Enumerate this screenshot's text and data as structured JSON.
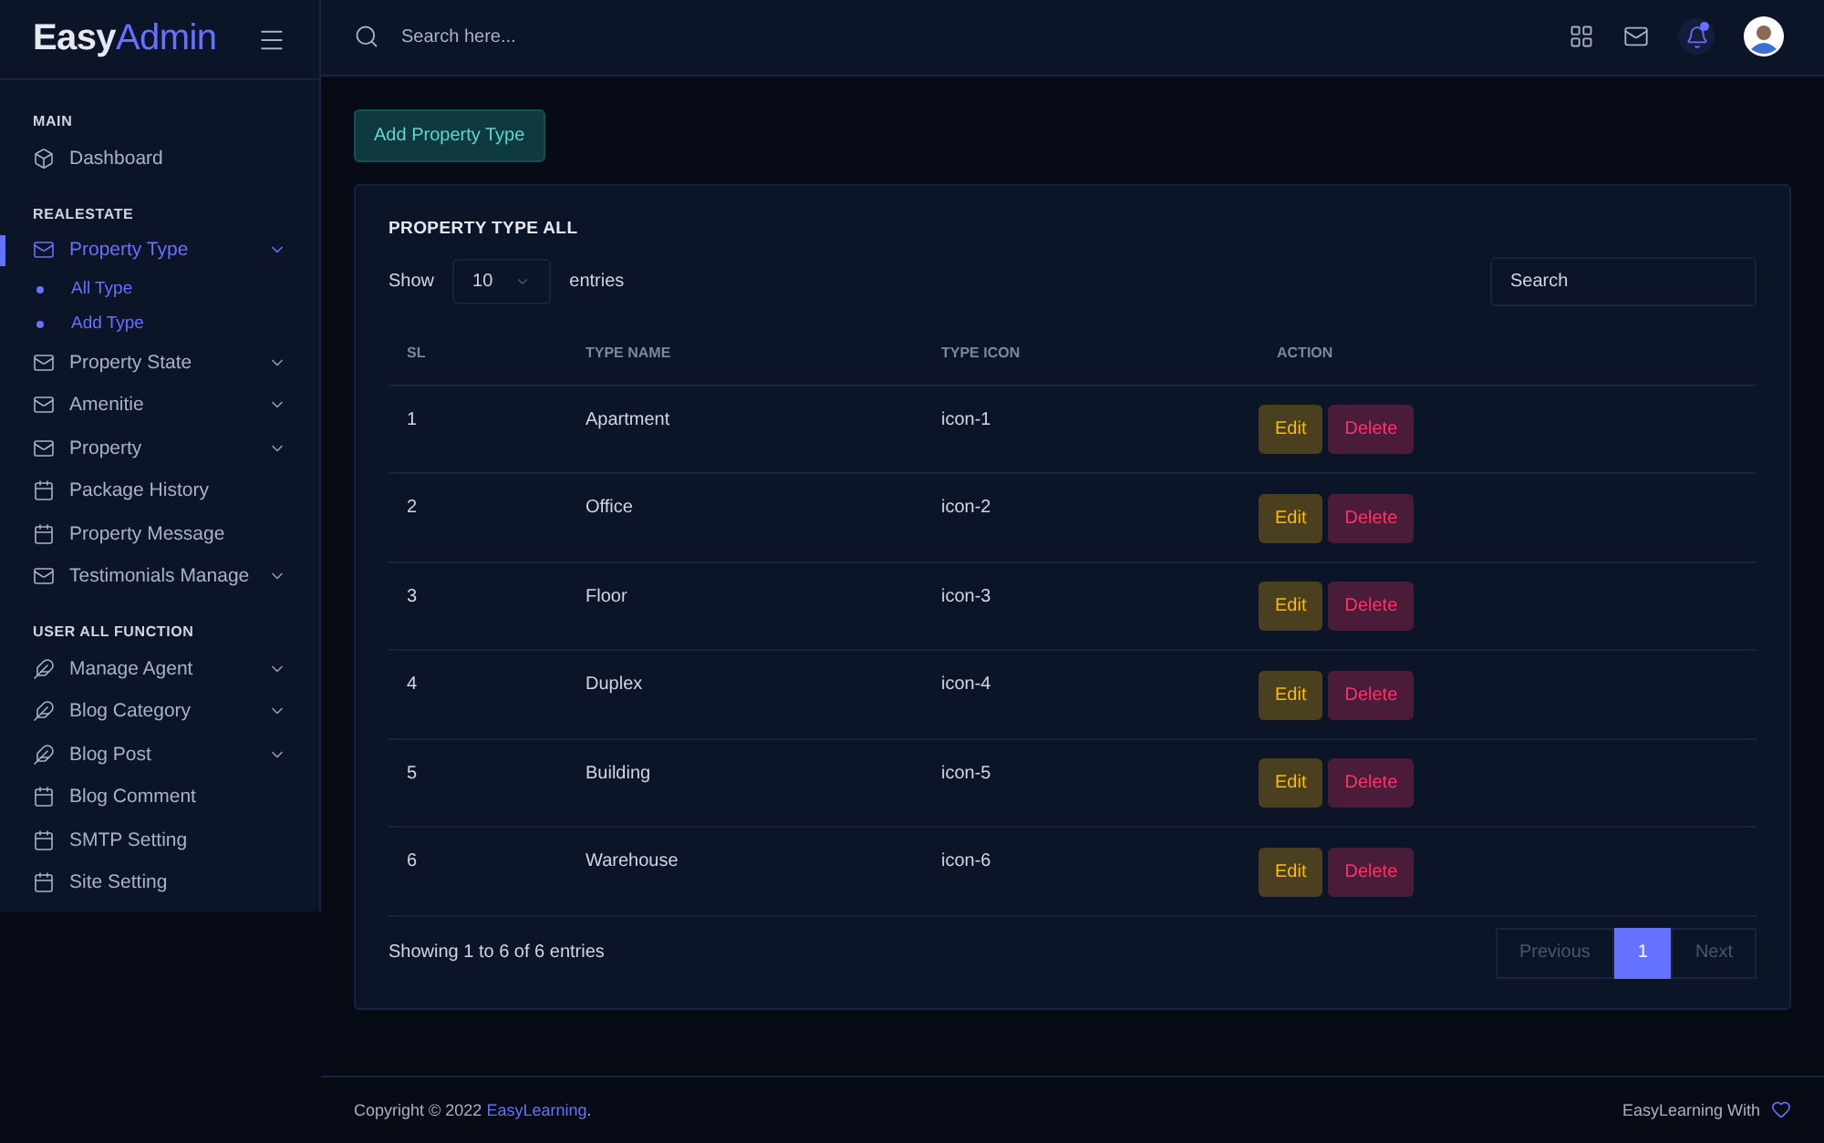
{
  "brand": {
    "strong": "Easy",
    "light": "Admin"
  },
  "search": {
    "placeholder": "Search here..."
  },
  "sidebar": {
    "sections": [
      {
        "title": "MAIN",
        "items": [
          {
            "label": "Dashboard",
            "kind": "cube",
            "selected": false,
            "submenu": false
          }
        ]
      },
      {
        "title": "REALESTATE",
        "items": [
          {
            "label": "Property Type",
            "kind": "envelope",
            "selected": true,
            "submenu": true,
            "expanded": true,
            "children": [
              "All Type",
              "Add Type"
            ]
          },
          {
            "label": "Property State",
            "kind": "envelope",
            "selected": false,
            "submenu": true,
            "expanded": false
          },
          {
            "label": "Amenitie",
            "kind": "envelope",
            "selected": false,
            "submenu": true,
            "expanded": false
          },
          {
            "label": "Property",
            "kind": "envelope",
            "selected": false,
            "submenu": true,
            "expanded": false
          },
          {
            "label": "Package History",
            "kind": "calendar",
            "selected": false,
            "submenu": false
          },
          {
            "label": "Property Message",
            "kind": "calendar",
            "selected": false,
            "submenu": false
          },
          {
            "label": "Testimonials Manage",
            "kind": "envelope",
            "selected": false,
            "submenu": true,
            "expanded": false
          }
        ]
      },
      {
        "title": "USER ALL FUNCTION",
        "items": [
          {
            "label": "Manage Agent",
            "kind": "feather",
            "selected": false,
            "submenu": true,
            "expanded": false
          },
          {
            "label": "Blog Category",
            "kind": "feather",
            "selected": false,
            "submenu": true,
            "expanded": false
          },
          {
            "label": "Blog Post",
            "kind": "feather",
            "selected": false,
            "submenu": true,
            "expanded": false
          },
          {
            "label": "Blog Comment",
            "kind": "calendar",
            "selected": false,
            "submenu": false
          },
          {
            "label": "SMTP Setting",
            "kind": "calendar",
            "selected": false,
            "submenu": false
          },
          {
            "label": "Site Setting",
            "kind": "calendar",
            "selected": false,
            "submenu": false
          }
        ]
      }
    ]
  },
  "add_button": "Add Property Type",
  "card": {
    "title": "PROPERTY TYPE ALL",
    "show_label": "Show",
    "page_size": "10",
    "entries_label": "entries",
    "search_placeholder": "Search",
    "columns": [
      "SL",
      "TYPE NAME",
      "TYPE ICON",
      "ACTION"
    ],
    "rows": [
      {
        "sl": "1",
        "name": "Apartment",
        "icon": "icon-1",
        "edit": "Edit",
        "delete": "Delete"
      },
      {
        "sl": "2",
        "name": "Office",
        "icon": "icon-2",
        "edit": "Edit",
        "delete": "Delete"
      },
      {
        "sl": "3",
        "name": "Floor",
        "icon": "icon-3",
        "edit": "Edit",
        "delete": "Delete"
      },
      {
        "sl": "4",
        "name": "Duplex",
        "icon": "icon-4",
        "edit": "Edit",
        "delete": "Delete"
      },
      {
        "sl": "5",
        "name": "Building",
        "icon": "icon-5",
        "edit": "Edit",
        "delete": "Delete"
      },
      {
        "sl": "6",
        "name": "Warehouse",
        "icon": "icon-6",
        "edit": "Edit",
        "delete": "Delete"
      }
    ],
    "info": "Showing 1 to 6 of 6 entries",
    "pagination": [
      {
        "label": "Previous",
        "selected": false
      },
      {
        "label": "1",
        "selected": true
      },
      {
        "label": "Next",
        "selected": false
      }
    ]
  },
  "footer": {
    "copyright": "Copyright © 2022 ",
    "link": "EasyLearning",
    "after": ".",
    "right": "EasyLearning With"
  }
}
